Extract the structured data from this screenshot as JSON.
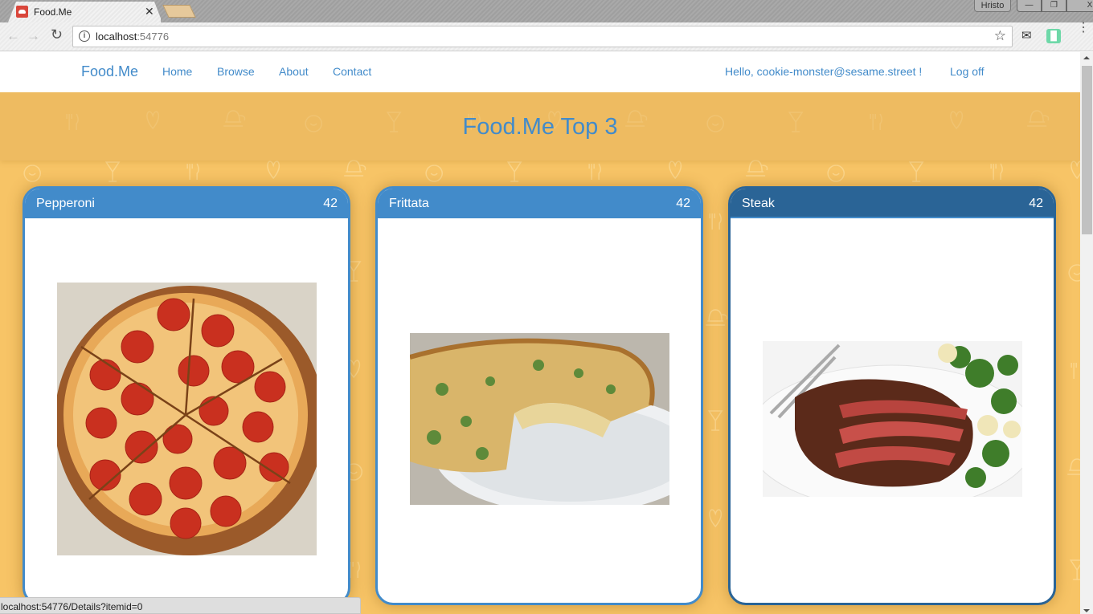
{
  "browser": {
    "tab_title": "Food.Me",
    "tab_close": "✕",
    "profile_name": "Hristo",
    "window_buttons": {
      "minimize": "—",
      "restore": "❐",
      "close": "X"
    },
    "back_icon": "←",
    "forward_icon": "→",
    "reload_icon": "C",
    "info_icon": "i",
    "url_host": "localhost",
    "url_port": ":54776",
    "bookmark_icon": "☆",
    "mail_icon": "✉",
    "sound_icon": "▮▮▮",
    "menu_icon": "⋮",
    "status_url": "localhost:54776/Details?itemid=0"
  },
  "navbar": {
    "brand": "Food.Me",
    "links": [
      "Home",
      "Browse",
      "About",
      "Contact"
    ],
    "greeting": "Hello, cookie-monster@sesame.street !",
    "logoff": "Log off"
  },
  "hero": {
    "title": "Food.Me Top 3"
  },
  "cards": [
    {
      "title": "Pepperoni",
      "count": "42",
      "image": "pepperoni pizza"
    },
    {
      "title": "Frittata",
      "count": "42",
      "image": "frittata on plate"
    },
    {
      "title": "Steak",
      "count": "42",
      "image": "sliced steak with broccoli"
    }
  ],
  "colors": {
    "accent": "#428bca",
    "accent_dark": "#2a6496",
    "background": "#f7c466",
    "hero_band": "#edb95c"
  }
}
